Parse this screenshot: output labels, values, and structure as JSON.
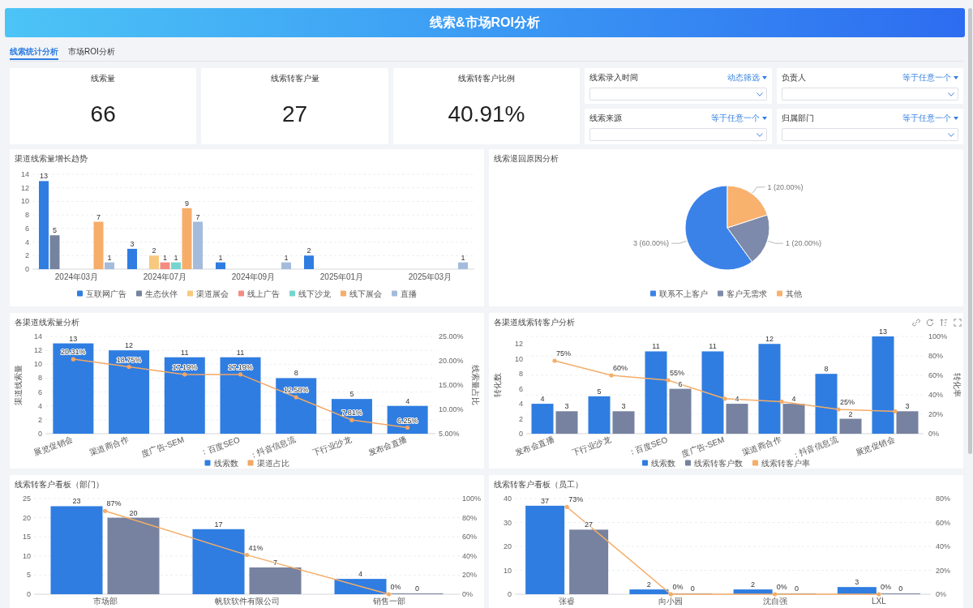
{
  "header": {
    "title": "线索&市场ROI分析"
  },
  "tabs": [
    {
      "label": "线索统计分析",
      "selected": true
    },
    {
      "label": "市场ROI分析",
      "selected": false
    }
  ],
  "kpis": [
    {
      "label": "线索量",
      "value": "66"
    },
    {
      "label": "线索转客户量",
      "value": "27"
    },
    {
      "label": "线索转客户比例",
      "value": "40.91%"
    }
  ],
  "filters": [
    {
      "label": "线索录入时间",
      "mode": "动态筛选"
    },
    {
      "label": "负责人",
      "mode": "等于任意一个"
    },
    {
      "label": "线索来源",
      "mode": "等于任意一个"
    },
    {
      "label": "归属部门",
      "mode": "等于任意一个"
    }
  ],
  "panels": [
    {
      "title": "渠道线索量增长趋势",
      "toolbar": false,
      "chart_data": {
        "type": "bar",
        "categories": [
          "2024年03月",
          "2024年07月",
          "2024年09月",
          "2025年01月",
          "2025年03月"
        ],
        "ylim": [
          0,
          14
        ],
        "yticks": [
          0,
          2,
          4,
          6,
          8,
          10,
          12,
          14
        ],
        "grid": true,
        "data_labels": true,
        "legend": true,
        "series": [
          {
            "name": "互联网广告",
            "color": "#2f7de1",
            "values": [
              13,
              3,
              1,
              2,
              null
            ]
          },
          {
            "name": "生态伙伴",
            "color": "#76839f",
            "values": [
              5,
              null,
              null,
              null,
              null
            ]
          },
          {
            "name": "渠道展会",
            "color": "#f7c97e",
            "values": [
              null,
              2,
              null,
              null,
              null
            ]
          },
          {
            "name": "线上广告",
            "color": "#f58c82",
            "values": [
              null,
              1,
              null,
              null,
              null
            ]
          },
          {
            "name": "线下沙龙",
            "color": "#74d6cf",
            "values": [
              null,
              1,
              null,
              null,
              null
            ]
          },
          {
            "name": "线下展会",
            "color": "#f7ad6a",
            "values": [
              7,
              9,
              null,
              null,
              null
            ]
          },
          {
            "name": "直播",
            "color": "#a5bbdc",
            "values": [
              1,
              7,
              1,
              null,
              1
            ]
          }
        ]
      }
    },
    {
      "title": "线索退回原因分析",
      "toolbar": false,
      "chart_data": {
        "type": "pie",
        "legend": true,
        "categories": [
          "联系不上客户",
          "客户无需求",
          "其他"
        ],
        "values": [
          3,
          1,
          1
        ],
        "colors": [
          "#3b82e8",
          "#7d8aab",
          "#f9b16e"
        ],
        "value_labels": [
          "3 (60.00%)",
          "1 (20.00%)",
          "1 (20.00%)"
        ]
      }
    },
    {
      "title": "各渠道线索量分析",
      "toolbar": false,
      "chart_data": {
        "type": "bar",
        "categories": [
          "展览促销会",
          "渠道商合作",
          "度广告-SEM",
          "：百度SEO",
          "：抖音信息流",
          "下行业沙龙",
          "发布会直播"
        ],
        "ylabel": "渠道线索量",
        "ylim": [
          0,
          14
        ],
        "yticks": [
          0,
          2,
          4,
          6,
          8,
          10,
          12,
          14
        ],
        "y2label": "线索量占比",
        "y2lim": [
          5,
          25
        ],
        "y2ticks": [
          {
            "value": 5,
            "label": "5.00%"
          },
          {
            "value": 10,
            "label": "10.00%"
          },
          {
            "value": 15,
            "label": "15.00%"
          },
          {
            "value": 20,
            "label": "20.00%"
          },
          {
            "value": 25,
            "label": "25.00%"
          }
        ],
        "grid": true,
        "data_labels": true,
        "legend": true,
        "series": [
          {
            "name": "线索数",
            "type": "bar",
            "color": "#2f7de1",
            "values": [
              13,
              12,
              11,
              11,
              8,
              5,
              4
            ]
          },
          {
            "name": "渠道占比",
            "type": "line",
            "axis": "y2",
            "color": "#f2a765",
            "values": [
              20.31,
              18.75,
              17.19,
              17.19,
              12.5,
              7.81,
              6.25
            ],
            "value_labels": [
              "20.31%",
              "18.75%",
              "17.19%",
              "17.19%",
              "12.50%",
              "7.81%",
              "6.25%"
            ]
          }
        ]
      }
    },
    {
      "title": "各渠道线索转客户分析",
      "toolbar": true,
      "chart_data": {
        "type": "bar",
        "categories": [
          "发布会直播",
          "下行业沙龙",
          "：百度SEO",
          "度广告-SEM",
          "渠道商合作",
          "：抖音信息流",
          "展览促销会"
        ],
        "ylabel": "转化数",
        "ylim": [
          0,
          13
        ],
        "yticks": [
          0,
          2,
          4,
          6,
          8,
          10,
          12
        ],
        "y2label": "转化率",
        "y2lim": [
          0,
          100
        ],
        "y2ticks": [
          {
            "value": 0,
            "label": "0%"
          },
          {
            "value": 20,
            "label": "20%"
          },
          {
            "value": 40,
            "label": "40%"
          },
          {
            "value": 60,
            "label": "60%"
          },
          {
            "value": 80,
            "label": "80%"
          },
          {
            "value": 100,
            "label": "100%"
          }
        ],
        "grid": true,
        "data_labels": true,
        "legend": true,
        "series": [
          {
            "name": "线索数",
            "type": "bar",
            "color": "#2f7de1",
            "values": [
              4,
              5,
              11,
              11,
              12,
              8,
              13
            ]
          },
          {
            "name": "线索转客户数",
            "type": "bar",
            "color": "#76829f",
            "values": [
              3,
              3,
              6,
              4,
              4,
              2,
              3
            ]
          },
          {
            "name": "线索转客户率",
            "type": "line",
            "axis": "y2",
            "color": "#f5ad68",
            "values": [
              75,
              60,
              55,
              36,
              33,
              25,
              23
            ],
            "value_labels": [
              "75%",
              "60%",
              "55%",
              null,
              null,
              "25%",
              null
            ]
          }
        ]
      }
    },
    {
      "title": "线索转客户看板（部门）",
      "toolbar": false,
      "chart_data": {
        "type": "bar",
        "categories": [
          "市场部",
          "帆软软件有限公司",
          "销售一部"
        ],
        "ylim": [
          0,
          25
        ],
        "yticks": [
          0,
          5,
          10,
          15,
          20,
          25
        ],
        "y2lim": [
          0,
          100
        ],
        "y2ticks": [
          {
            "value": 0,
            "label": "0%"
          },
          {
            "value": 20,
            "label": "20%"
          },
          {
            "value": 40,
            "label": "40%"
          },
          {
            "value": 60,
            "label": "60%"
          },
          {
            "value": 80,
            "label": "80%"
          },
          {
            "value": 100,
            "label": "100%"
          }
        ],
        "grid": true,
        "data_labels": true,
        "series": [
          {
            "type": "bar",
            "color": "#2f7de1",
            "values": [
              23,
              17,
              4
            ]
          },
          {
            "type": "bar",
            "color": "#76829f",
            "values": [
              20,
              7,
              0
            ]
          },
          {
            "type": "line",
            "axis": "y2",
            "color": "#f5ad68",
            "values": [
              87,
              41,
              0
            ],
            "value_labels": [
              "87%",
              "41%",
              "0%"
            ]
          }
        ]
      }
    },
    {
      "title": "线索转客户看板（员工）",
      "toolbar": false,
      "chart_data": {
        "type": "bar",
        "categories": [
          "张睿",
          "向小园",
          "沈自强",
          "LXL"
        ],
        "ylim": [
          0,
          40
        ],
        "yticks": [
          0,
          10,
          20,
          30,
          40
        ],
        "y2lim": [
          0,
          80
        ],
        "y2ticks": [
          {
            "value": 0,
            "label": "0%"
          },
          {
            "value": 20,
            "label": "20%"
          },
          {
            "value": 40,
            "label": "40%"
          },
          {
            "value": 60,
            "label": "60%"
          },
          {
            "value": 80,
            "label": "80%"
          }
        ],
        "grid": true,
        "data_labels": true,
        "series": [
          {
            "type": "bar",
            "color": "#2f7de1",
            "values": [
              37,
              2,
              2,
              3
            ]
          },
          {
            "type": "bar",
            "color": "#76829f",
            "values": [
              27,
              0,
              0,
              0
            ]
          },
          {
            "type": "line",
            "axis": "y2",
            "color": "#f5ad68",
            "values": [
              73,
              0,
              0,
              0
            ],
            "value_labels": [
              "73%",
              "0%",
              "0%",
              "0%"
            ]
          }
        ]
      }
    }
  ]
}
